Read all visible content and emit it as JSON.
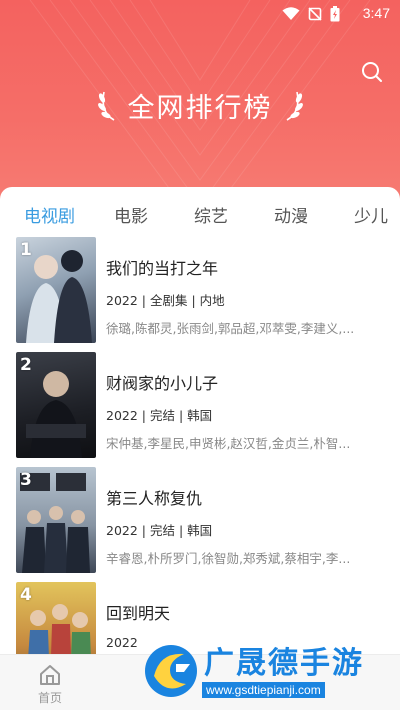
{
  "status_bar": {
    "time": "3:47"
  },
  "header": {
    "title": "全网排行榜"
  },
  "tabs": [
    {
      "label": "电视剧",
      "active": true
    },
    {
      "label": "电影",
      "active": false
    },
    {
      "label": "综艺",
      "active": false
    },
    {
      "label": "动漫",
      "active": false
    },
    {
      "label": "少儿",
      "active": false
    }
  ],
  "items": [
    {
      "rank": "1",
      "name": "我们的当打之年",
      "meta": "2022 | 全剧集 | 内地",
      "cast": "徐璐,陈都灵,张雨剑,郭品超,邓萃雯,李建义,..."
    },
    {
      "rank": "2",
      "name": "财阀家的小儿子",
      "meta": "2022 | 完结 | 韩国",
      "cast": "宋仲基,李星民,申贤彬,赵汉哲,金贞兰,朴智..."
    },
    {
      "rank": "3",
      "name": "第三人称复仇",
      "meta": "2022 | 完结 | 韩国",
      "cast": "辛睿恩,朴所罗门,徐智勋,郑秀斌,蔡相宇,李..."
    },
    {
      "rank": "4",
      "name": "回到明天",
      "meta": "2022",
      "cast": ""
    }
  ],
  "bottom_nav": {
    "home_label": "首页"
  },
  "watermark": {
    "text": "广晟德手游",
    "url": "www.gsdtiepianji.com"
  },
  "colors": {
    "header": "#f4625f",
    "tab_active": "#3a9ce0",
    "watermark": "#1a84e0"
  },
  "icons": [
    "wifi-icon",
    "sim-off-icon",
    "battery-icon",
    "search-icon",
    "laurel-left-icon",
    "laurel-right-icon",
    "home-icon"
  ]
}
